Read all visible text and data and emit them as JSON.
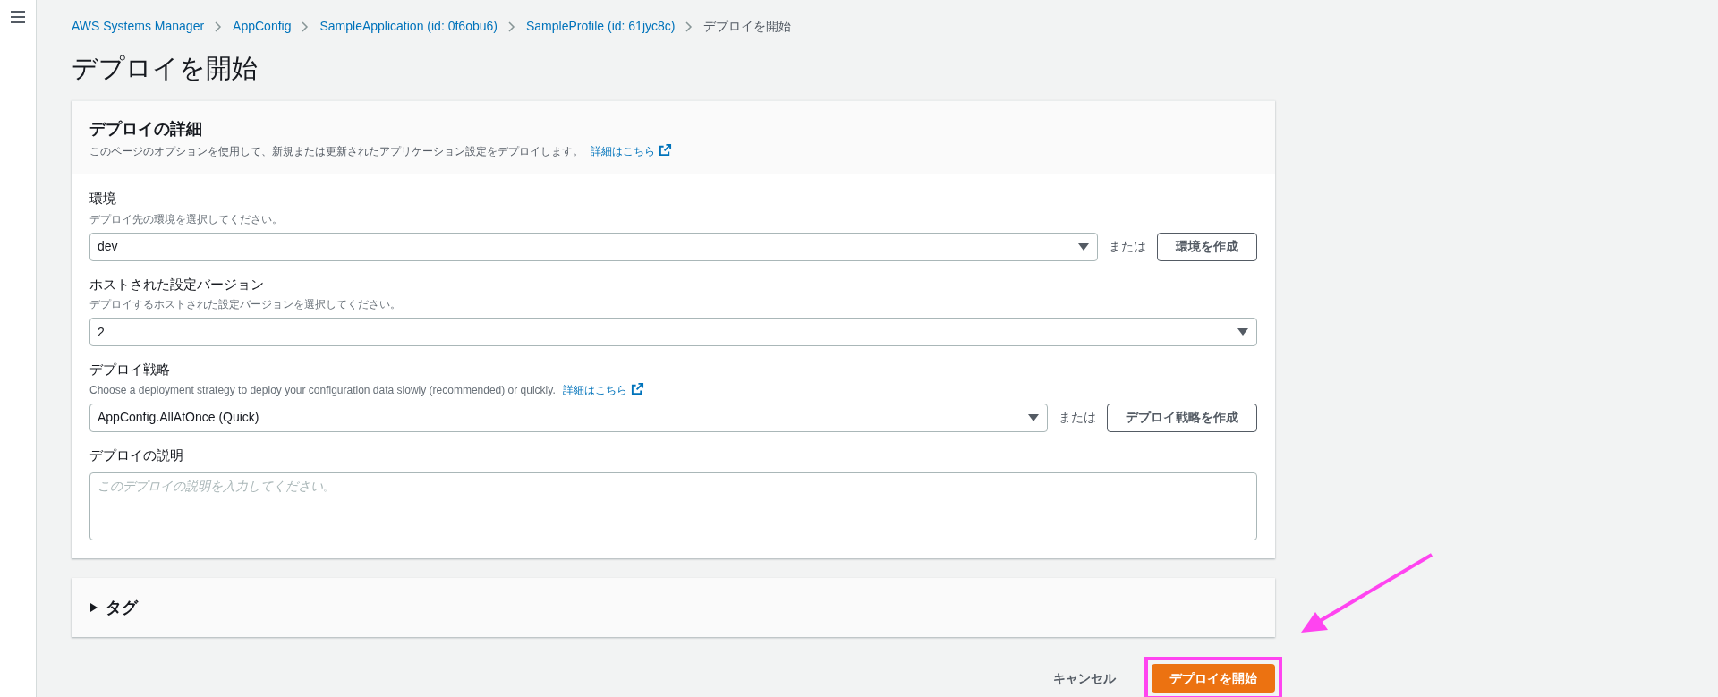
{
  "breadcrumbs": [
    {
      "label": "AWS Systems Manager",
      "link": true
    },
    {
      "label": "AppConfig",
      "link": true
    },
    {
      "label": "SampleApplication (id: 0f6obu6)",
      "link": true
    },
    {
      "label": "SampleProfile (id: 61jyc8c)",
      "link": true
    },
    {
      "label": "デプロイを開始",
      "link": false
    }
  ],
  "page_title": "デプロイを開始",
  "details": {
    "title": "デプロイの詳細",
    "description": "このページのオプションを使用して、新規または更新されたアプリケーション設定をデプロイします。",
    "link": "詳細はこちら",
    "fields": [
      {
        "kind": "select",
        "label": "環境",
        "hint": "デプロイ先の環境を選択してください。",
        "value": "dev",
        "or": "または",
        "create_button": "環境を作成"
      },
      {
        "kind": "select",
        "label": "ホストされた設定バージョン",
        "hint": "デプロイするホストされた設定バージョンを選択してください。",
        "value": "2"
      },
      {
        "kind": "select",
        "label": "デプロイ戦略",
        "hint": "Choose a deployment strategy to deploy your configuration data slowly (recommended) or quickly.",
        "hint_link": "詳細はこちら",
        "value": "AppConfig.AllAtOnce (Quick)",
        "or": "または",
        "create_button": "デプロイ戦略を作成"
      },
      {
        "kind": "textarea",
        "label": "デプロイの説明",
        "placeholder": "このデプロイの説明を入力してください。"
      }
    ]
  },
  "tags": {
    "title": "タグ",
    "expanded": false
  },
  "footer": {
    "cancel": "キャンセル",
    "submit": "デプロイを開始"
  }
}
